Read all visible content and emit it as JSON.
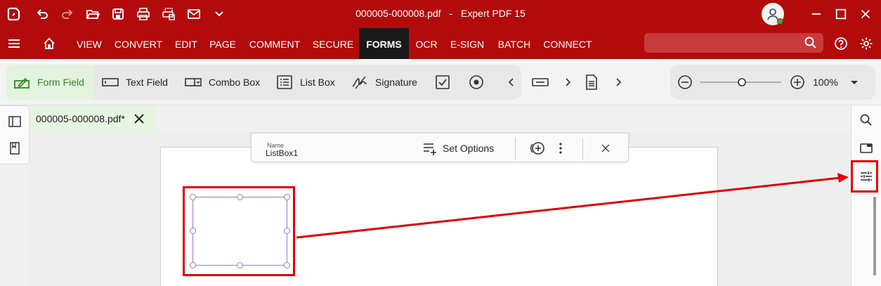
{
  "window": {
    "file_name": "000005-000008.pdf",
    "separator": "-",
    "app_name": "Expert PDF 15"
  },
  "menu": {
    "items": [
      "VIEW",
      "CONVERT",
      "EDIT",
      "PAGE",
      "COMMENT",
      "SECURE",
      "FORMS",
      "OCR",
      "E-SIGN",
      "BATCH",
      "CONNECT"
    ],
    "active": "FORMS",
    "search_placeholder": ""
  },
  "ribbon": {
    "form_field": "Form Field",
    "text_field": "Text Field",
    "combo_box": "Combo Box",
    "list_box": "List Box",
    "signature": "Signature",
    "zoom": "100%"
  },
  "tab": {
    "label": "000005-000008.pdf*"
  },
  "field_toolbar": {
    "name_label": "Name",
    "name_value": "ListBox1",
    "set_options": "Set Options"
  },
  "colors": {
    "brand_red": "#b30b0b",
    "active_tab": "#1a1a1a",
    "form_field_green": "#2c8a1f",
    "highlight_red": "#e00000",
    "field_border": "#9b7bc2"
  }
}
